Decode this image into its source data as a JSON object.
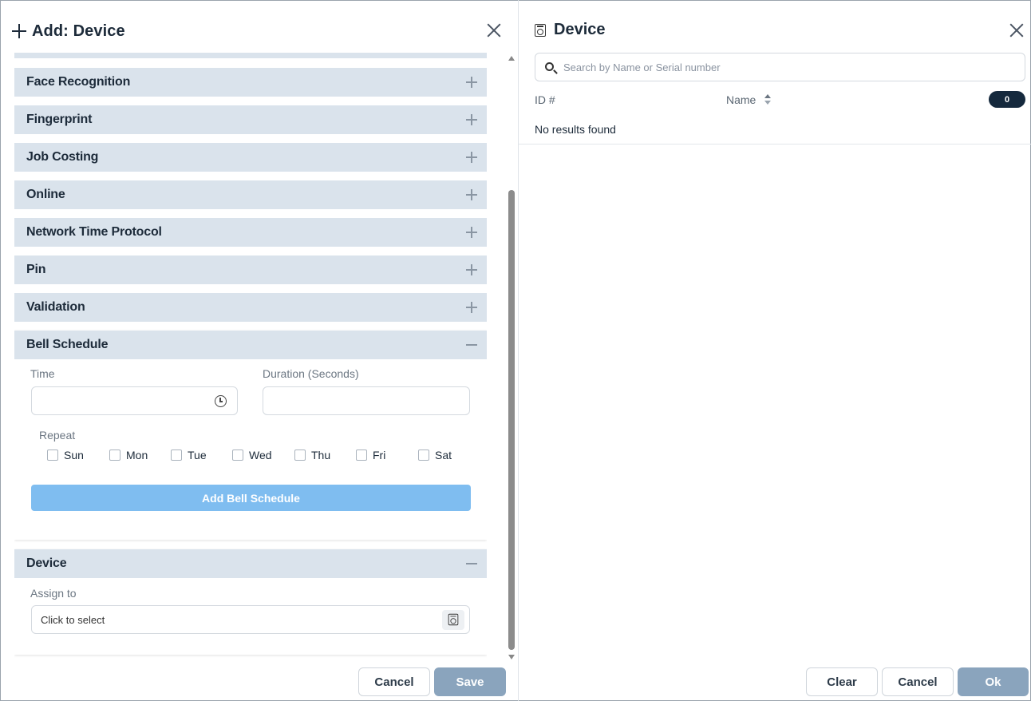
{
  "left_dialog": {
    "title": "Add: Device",
    "sections": [
      {
        "label": "Face Recognition",
        "state": "collapsed"
      },
      {
        "label": "Fingerprint",
        "state": "collapsed"
      },
      {
        "label": "Job Costing",
        "state": "collapsed"
      },
      {
        "label": "Online",
        "state": "collapsed"
      },
      {
        "label": "Network Time Protocol",
        "state": "collapsed"
      },
      {
        "label": "Pin",
        "state": "collapsed"
      },
      {
        "label": "Validation",
        "state": "collapsed"
      },
      {
        "label": "Bell Schedule",
        "state": "expanded"
      },
      {
        "label": "Device",
        "state": "expanded"
      }
    ],
    "bell_schedule": {
      "time_label": "Time",
      "time_value": "",
      "duration_label": "Duration (Seconds)",
      "duration_value": "",
      "repeat_label": "Repeat",
      "days": [
        "Sun",
        "Mon",
        "Tue",
        "Wed",
        "Thu",
        "Fri",
        "Sat"
      ],
      "add_button": "Add Bell Schedule"
    },
    "device_section": {
      "assign_label": "Assign to",
      "assign_placeholder": "Click to select"
    },
    "footer": {
      "cancel": "Cancel",
      "save": "Save"
    }
  },
  "right_dialog": {
    "title": "Device",
    "search_placeholder": "Search by Name or Serial number",
    "columns": {
      "id": "ID #",
      "name": "Name"
    },
    "count": "0",
    "empty_message": "No results found",
    "footer": {
      "clear": "Clear",
      "cancel": "Cancel",
      "ok": "Ok"
    }
  },
  "colors": {
    "section_header": "#dae3ec",
    "primary_button": "#7fbdf0",
    "disabled_button": "#8aa4bd",
    "badge": "#15293d"
  }
}
